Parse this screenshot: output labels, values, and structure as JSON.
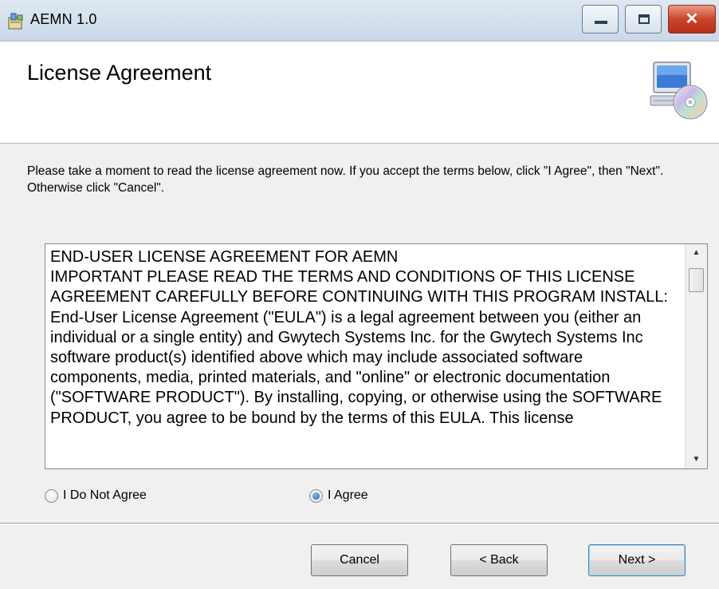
{
  "window": {
    "title": "AEMN 1.0",
    "close_glyph": "✕"
  },
  "header": {
    "title": "License Agreement",
    "icon": "computer-cd-icon"
  },
  "instructions": "Please take a moment to read the license agreement now. If you accept the terms below, click \"I Agree\", then \"Next\". Otherwise click \"Cancel\".",
  "license": {
    "text": "END-USER LICENSE AGREEMENT FOR AEMN\nIMPORTANT PLEASE READ THE TERMS AND CONDITIONS OF THIS LICENSE AGREEMENT CAREFULLY BEFORE CONTINUING WITH THIS PROGRAM INSTALL:  End-User License Agreement (\"EULA\") is a legal agreement between you (either an individual or a single entity) and Gwytech Systems Inc. for the Gwytech Systems Inc software product(s) identified above which may include associated software components, media, printed materials, and \"online\" or electronic documentation (\"SOFTWARE PRODUCT\"). By installing, copying, or otherwise using the SOFTWARE PRODUCT, you agree to be bound by the terms of this EULA. This license"
  },
  "options": {
    "disagree_label": "I Do Not Agree",
    "agree_label": "I Agree",
    "selected": "agree"
  },
  "buttons": {
    "cancel": "Cancel",
    "back": "< Back",
    "next": "Next >"
  },
  "colors": {
    "titlebar": "#c9d8e8",
    "close_button": "#c8452b",
    "radio_selected": "#1b5fb0"
  }
}
